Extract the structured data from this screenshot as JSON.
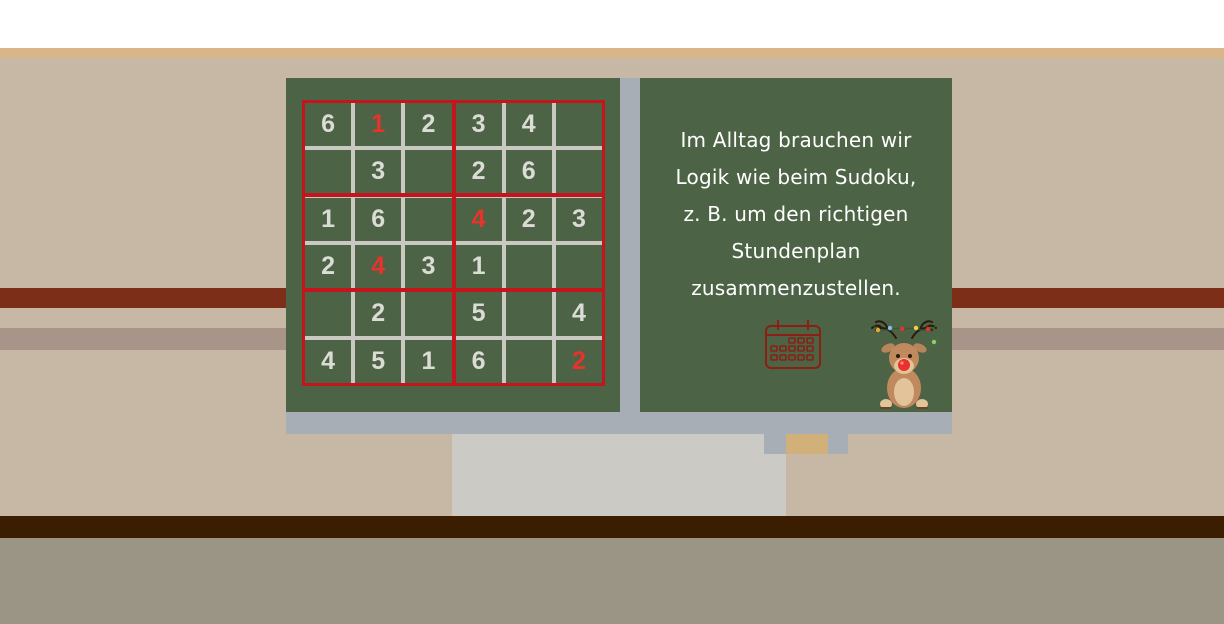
{
  "scene": "Klassenzimmer-Tafel mit Sudoku",
  "colors": {
    "wall": "#c6b8a4",
    "chalkboard": "#4d6346",
    "grid_lines": "#c9c9c2",
    "box_border": "#c4151c",
    "given_digit": "#dcdcd6",
    "solved_digit": "#e8322b"
  },
  "sudoku": {
    "size": 6,
    "box_rows": 2,
    "box_cols": 3,
    "cells": [
      [
        {
          "v": "6"
        },
        {
          "v": "1",
          "red": true
        },
        {
          "v": "2"
        },
        {
          "v": "3"
        },
        {
          "v": "4"
        },
        {
          "v": ""
        }
      ],
      [
        {
          "v": ""
        },
        {
          "v": "3"
        },
        {
          "v": ""
        },
        {
          "v": "2"
        },
        {
          "v": "6"
        },
        {
          "v": ""
        }
      ],
      [
        {
          "v": "1"
        },
        {
          "v": "6"
        },
        {
          "v": ""
        },
        {
          "v": "4",
          "red": true
        },
        {
          "v": "2"
        },
        {
          "v": "3"
        }
      ],
      [
        {
          "v": "2"
        },
        {
          "v": "4",
          "red": true
        },
        {
          "v": "3"
        },
        {
          "v": "1"
        },
        {
          "v": ""
        },
        {
          "v": ""
        }
      ],
      [
        {
          "v": ""
        },
        {
          "v": "2"
        },
        {
          "v": ""
        },
        {
          "v": "5"
        },
        {
          "v": ""
        },
        {
          "v": "4"
        }
      ],
      [
        {
          "v": "4"
        },
        {
          "v": "5"
        },
        {
          "v": "1"
        },
        {
          "v": "6"
        },
        {
          "v": ""
        },
        {
          "v": "2",
          "red": true
        }
      ]
    ]
  },
  "board_text": {
    "line1": "Im Alltag brauchen wir",
    "line2": "Logik wie beim Sudoku,",
    "line3": "z. B. um den richtigen",
    "line4": "Stundenplan",
    "line5": "zusammenzustellen."
  },
  "icons": [
    "calendar-icon",
    "reindeer-illustration"
  ]
}
